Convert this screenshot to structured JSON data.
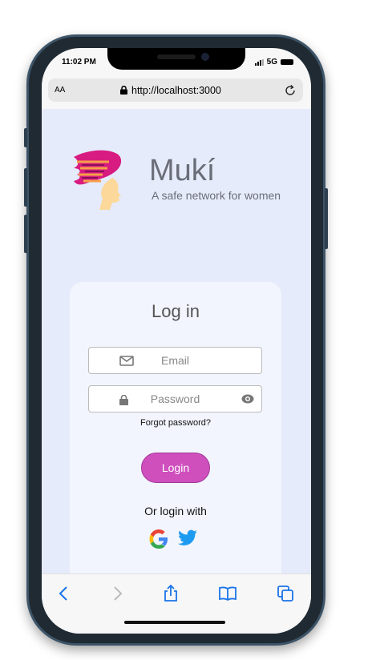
{
  "status_bar": {
    "time": "11:02 PM",
    "network": "5G"
  },
  "browser": {
    "text_size_label": "AA",
    "url": "http://localhost:3000"
  },
  "app": {
    "name": "Mukí",
    "tagline": "A safe network for women"
  },
  "login_card": {
    "title": "Log in",
    "email_placeholder": "Email",
    "password_placeholder": "Password",
    "forgot_password": "Forgot password?",
    "login_button": "Login",
    "social_label": "Or login with"
  },
  "colors": {
    "accent": "#cf4fbd",
    "background": "#e6ebfb",
    "card": "#f2f5fd",
    "twitter": "#1d9bf0",
    "toolbar_icon": "#1a73e8"
  }
}
